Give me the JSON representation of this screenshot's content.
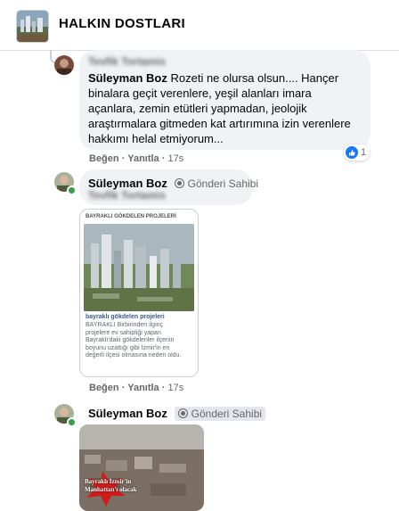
{
  "header": {
    "group_name": "HALKIN DOSTLARI"
  },
  "comments": [
    {
      "author": "Tevfik Tortamis",
      "text": "Süleyman Boz Rozeti ne olursa olsun.... Hançer binalara geçit verenlere, yeşil alanları imara açanlara, zemin etütleri yapmadan, jeolojik araştırmalara gitmeden kat artırımına izin verenlere hakkımı helal etmiyorum...",
      "lines": [
        "Rozeti ne olursa olsun.... Hançer",
        "binalara geçit verenlere, yeşil alanları imara",
        "açanlara, zemin etütleri yapmadan, jeolojik",
        "araştırmalara gitmeden kat artırımına izin verenlere",
        "hakkımı helal etmiyorum..."
      ],
      "mention": "Süleyman Boz",
      "reaction_count": "1",
      "like_label": "Beğen",
      "reply_label": "Yanıtla",
      "time": "17s"
    },
    {
      "author": "Süleyman Boz",
      "badge": "Gönderi Sahibi",
      "mention_blurred": "Tevfik Tortamis",
      "card": {
        "source": "BAYRAKLI GÖKDELEN PROJELERİ",
        "caption": "bayraklı gökdelen projeleri",
        "desc": [
          "BAYRAKLI Birbirinden ilginç",
          "projelere ev sahipliği yapan",
          "Bayraklı'daki gökdelenler ilçenin",
          "boyunu uzattığı gibi İzmir'in en",
          "değerli ilçesi olmasına neden oldu."
        ]
      },
      "like_label": "Beğen",
      "reply_label": "Yanıtla",
      "time": "17s"
    },
    {
      "author": "Süleyman Boz",
      "badge": "Gönderi Sahibi",
      "photo_text": "Bayraklı İzmir'in Manhattan'ı olacak"
    }
  ],
  "colors": {
    "bubble": "#f0f2f5",
    "secondary_text": "#65676b",
    "like_blue": "#1877f2",
    "online_green": "#31a24c"
  },
  "icons": [
    "group-avatar",
    "user-avatar",
    "like-icon",
    "badge-icon",
    "online-dot"
  ]
}
